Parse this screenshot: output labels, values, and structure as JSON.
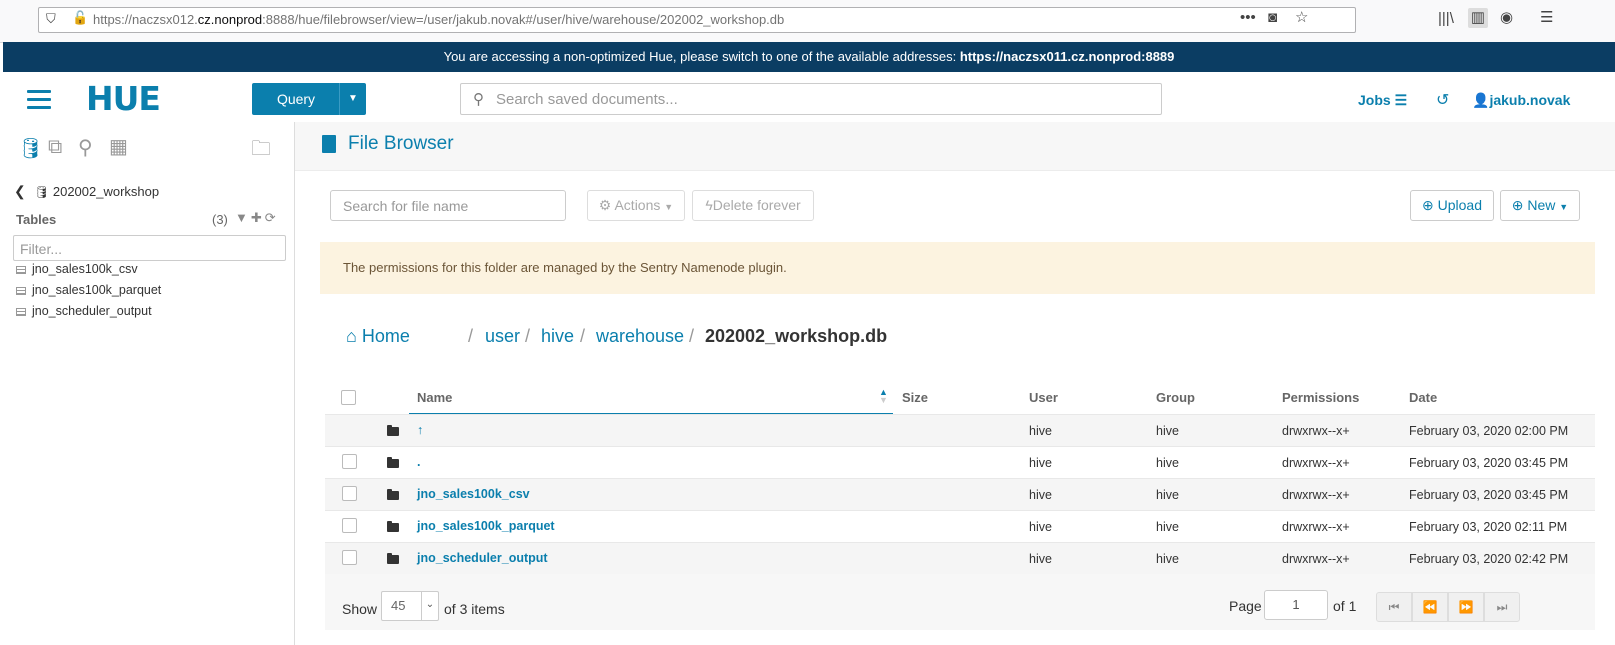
{
  "browser": {
    "url_prefix": "https://naczsx012.",
    "url_host": "cz.nonprod",
    "url_rest": ":8888/hue/filebrowser/view=/user/jakub.novak#/user/hive/warehouse/202002_workshop.db"
  },
  "banner": {
    "text": "You are accessing a non-optimized Hue, please switch to one of the available addresses: ",
    "link": "https://naczsx011.cz.nonprod:8889"
  },
  "header": {
    "logo": "HUE",
    "query_label": "Query",
    "search_placeholder": "Search saved documents...",
    "jobs_label": "Jobs",
    "user_label": "jakub.novak"
  },
  "sidebar": {
    "db_name": "202002_workshop",
    "tables_label": "Tables",
    "tables_count": "(3)",
    "filter_placeholder": "Filter...",
    "tables": [
      "jno_sales100k_csv",
      "jno_sales100k_parquet",
      "jno_scheduler_output"
    ]
  },
  "main": {
    "title": "File Browser",
    "search_placeholder": "Search for file name",
    "actions_label": "Actions",
    "delete_label": "Delete forever",
    "upload_label": "Upload",
    "new_label": "New",
    "alert": "The permissions for this folder are managed by the Sentry Namenode plugin.",
    "breadcrumb": {
      "home": "Home",
      "parts": [
        "user",
        "hive",
        "warehouse"
      ],
      "sep": "/",
      "current": "202002_workshop.db"
    },
    "columns": [
      "Name",
      "Size",
      "User",
      "Group",
      "Permissions",
      "Date"
    ],
    "rows": [
      {
        "name": "↑",
        "size": "",
        "user": "hive",
        "group": "hive",
        "perm": "drwxrwx--x+",
        "date": "February 03, 2020 02:00 PM"
      },
      {
        "name": ".",
        "size": "",
        "user": "hive",
        "group": "hive",
        "perm": "drwxrwx--x+",
        "date": "February 03, 2020 03:45 PM"
      },
      {
        "name": "jno_sales100k_csv",
        "size": "",
        "user": "hive",
        "group": "hive",
        "perm": "drwxrwx--x+",
        "date": "February 03, 2020 03:45 PM"
      },
      {
        "name": "jno_sales100k_parquet",
        "size": "",
        "user": "hive",
        "group": "hive",
        "perm": "drwxrwx--x+",
        "date": "February 03, 2020 02:11 PM"
      },
      {
        "name": "jno_scheduler_output",
        "size": "",
        "user": "hive",
        "group": "hive",
        "perm": "drwxrwx--x+",
        "date": "February 03, 2020 02:42 PM"
      }
    ],
    "pager": {
      "show_label": "Show",
      "page_size": "45",
      "items_text": "of 3 items",
      "page_label": "Page",
      "page_value": "1",
      "of_text": "of 1"
    }
  },
  "colors": {
    "accent": "#0b7fad",
    "banner": "#0b3d63",
    "alert_bg": "#fcf3e0"
  }
}
